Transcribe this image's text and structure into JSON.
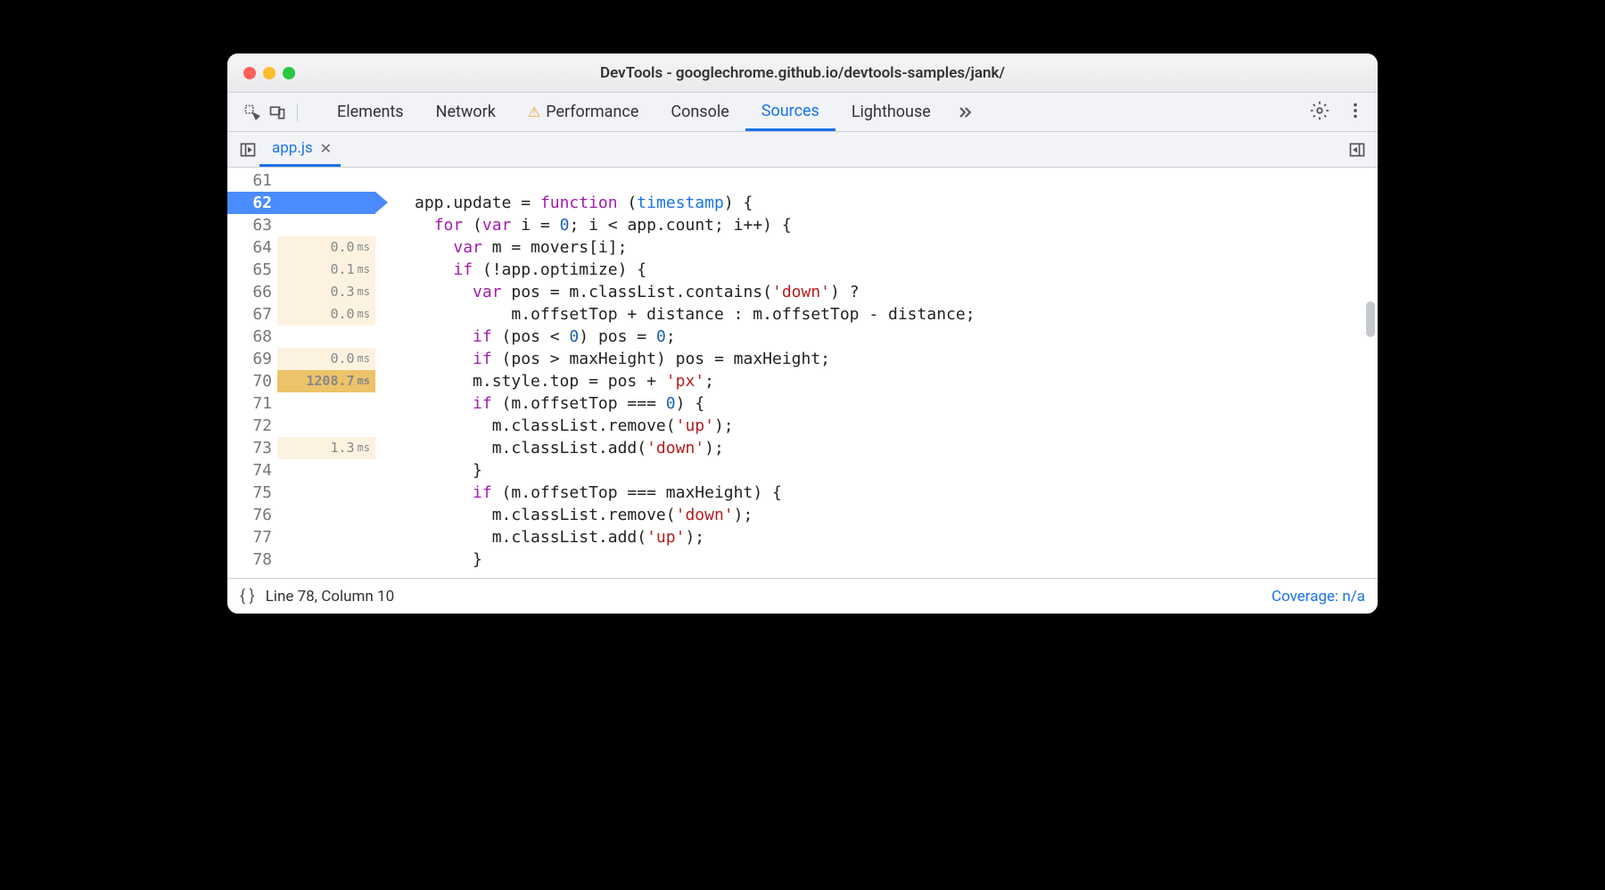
{
  "window": {
    "title": "DevTools - googlechrome.github.io/devtools-samples/jank/"
  },
  "toolbar": {
    "tabs": [
      {
        "label": "Elements",
        "active": false,
        "warn": false
      },
      {
        "label": "Network",
        "active": false,
        "warn": false
      },
      {
        "label": "Performance",
        "active": false,
        "warn": true
      },
      {
        "label": "Console",
        "active": false,
        "warn": false
      },
      {
        "label": "Sources",
        "active": true,
        "warn": false
      },
      {
        "label": "Lighthouse",
        "active": false,
        "warn": false
      }
    ]
  },
  "file_tab": {
    "name": "app.js"
  },
  "statusbar": {
    "position": "Line 78, Column 10",
    "coverage": "Coverage: n/a"
  },
  "gutter": [
    {
      "ln": "61",
      "time": "",
      "style": "none"
    },
    {
      "ln": "62",
      "time": "",
      "style": "exec"
    },
    {
      "ln": "63",
      "time": "",
      "style": "none"
    },
    {
      "ln": "64",
      "time": "0.0",
      "style": "light"
    },
    {
      "ln": "65",
      "time": "0.1",
      "style": "light"
    },
    {
      "ln": "66",
      "time": "0.3",
      "style": "light"
    },
    {
      "ln": "67",
      "time": "0.0",
      "style": "light"
    },
    {
      "ln": "68",
      "time": "",
      "style": "none"
    },
    {
      "ln": "69",
      "time": "0.0",
      "style": "light"
    },
    {
      "ln": "70",
      "time": "1208.7",
      "style": "hot"
    },
    {
      "ln": "71",
      "time": "",
      "style": "none"
    },
    {
      "ln": "72",
      "time": "",
      "style": "none"
    },
    {
      "ln": "73",
      "time": "1.3",
      "style": "light"
    },
    {
      "ln": "74",
      "time": "",
      "style": "none"
    },
    {
      "ln": "75",
      "time": "",
      "style": "none"
    },
    {
      "ln": "76",
      "time": "",
      "style": "none"
    },
    {
      "ln": "77",
      "time": "",
      "style": "none"
    },
    {
      "ln": "78",
      "time": "",
      "style": "none"
    }
  ],
  "code": [
    [
      {
        "t": "",
        "c": ""
      }
    ],
    [
      {
        "t": "",
        "c": "app.update = "
      },
      {
        "t": "kw",
        "c": "function"
      },
      {
        "t": "",
        "c": " ("
      },
      {
        "t": "param",
        "c": "timestamp"
      },
      {
        "t": "",
        "c": ") {"
      }
    ],
    [
      {
        "t": "",
        "c": "  "
      },
      {
        "t": "kw",
        "c": "for"
      },
      {
        "t": "",
        "c": " ("
      },
      {
        "t": "kw",
        "c": "var"
      },
      {
        "t": "",
        "c": " i = "
      },
      {
        "t": "num",
        "c": "0"
      },
      {
        "t": "",
        "c": "; i < app.count; i++) {"
      }
    ],
    [
      {
        "t": "",
        "c": "    "
      },
      {
        "t": "kw",
        "c": "var"
      },
      {
        "t": "",
        "c": " m = movers[i];"
      }
    ],
    [
      {
        "t": "",
        "c": "    "
      },
      {
        "t": "kw",
        "c": "if"
      },
      {
        "t": "",
        "c": " (!app.optimize) {"
      }
    ],
    [
      {
        "t": "",
        "c": "      "
      },
      {
        "t": "kw",
        "c": "var"
      },
      {
        "t": "",
        "c": " pos = m.classList.contains("
      },
      {
        "t": "str",
        "c": "'down'"
      },
      {
        "t": "",
        "c": ") ?"
      }
    ],
    [
      {
        "t": "",
        "c": "          m.offsetTop + distance : m.offsetTop - distance;"
      }
    ],
    [
      {
        "t": "",
        "c": "      "
      },
      {
        "t": "kw",
        "c": "if"
      },
      {
        "t": "",
        "c": " (pos < "
      },
      {
        "t": "num",
        "c": "0"
      },
      {
        "t": "",
        "c": ") pos = "
      },
      {
        "t": "num",
        "c": "0"
      },
      {
        "t": "",
        "c": ";"
      }
    ],
    [
      {
        "t": "",
        "c": "      "
      },
      {
        "t": "kw",
        "c": "if"
      },
      {
        "t": "",
        "c": " (pos > maxHeight) pos = maxHeight;"
      }
    ],
    [
      {
        "t": "",
        "c": "      m.style.top = pos + "
      },
      {
        "t": "str",
        "c": "'px'"
      },
      {
        "t": "",
        "c": ";"
      }
    ],
    [
      {
        "t": "",
        "c": "      "
      },
      {
        "t": "kw",
        "c": "if"
      },
      {
        "t": "",
        "c": " (m.offsetTop === "
      },
      {
        "t": "num",
        "c": "0"
      },
      {
        "t": "",
        "c": ") {"
      }
    ],
    [
      {
        "t": "",
        "c": "        m.classList.remove("
      },
      {
        "t": "str",
        "c": "'up'"
      },
      {
        "t": "",
        "c": ");"
      }
    ],
    [
      {
        "t": "",
        "c": "        m.classList.add("
      },
      {
        "t": "str",
        "c": "'down'"
      },
      {
        "t": "",
        "c": ");"
      }
    ],
    [
      {
        "t": "",
        "c": "      }"
      }
    ],
    [
      {
        "t": "",
        "c": "      "
      },
      {
        "t": "kw",
        "c": "if"
      },
      {
        "t": "",
        "c": " (m.offsetTop === maxHeight) {"
      }
    ],
    [
      {
        "t": "",
        "c": "        m.classList.remove("
      },
      {
        "t": "str",
        "c": "'down'"
      },
      {
        "t": "",
        "c": ");"
      }
    ],
    [
      {
        "t": "",
        "c": "        m.classList.add("
      },
      {
        "t": "str",
        "c": "'up'"
      },
      {
        "t": "",
        "c": ");"
      }
    ],
    [
      {
        "t": "",
        "c": "      }"
      }
    ]
  ]
}
